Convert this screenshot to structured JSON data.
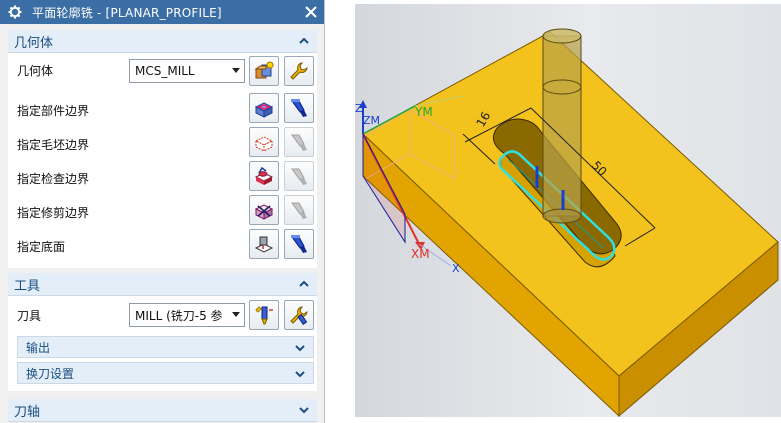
{
  "dialog": {
    "title": "平面轮廓铣 - [PLANAR_PROFILE]",
    "sections": {
      "geometry": {
        "header": "几何体",
        "geometry_label": "几何体",
        "geometry_value": "MCS_MILL",
        "rows": [
          "指定部件边界",
          "指定毛坯边界",
          "指定检查边界",
          "指定修剪边界",
          "指定底面"
        ]
      },
      "tool": {
        "header": "工具",
        "tool_label": "刀具",
        "tool_value": "MILL (铣刀-5 参",
        "sub": [
          "输出",
          "换刀设置"
        ]
      },
      "axis": {
        "header": "刀轴"
      }
    }
  },
  "viewport": {
    "axis_labels": {
      "zm": "ZM",
      "z": "Z",
      "ym": "YM",
      "xm": "XM",
      "x": "X"
    },
    "dimensions": [
      "16",
      "50"
    ],
    "colors": {
      "part": "#f3c21c",
      "toolpath": "#2fe0e0",
      "axis_x": "#e0302a",
      "axis_y": "#22a83a",
      "axis_z": "#1a3fd0"
    }
  }
}
